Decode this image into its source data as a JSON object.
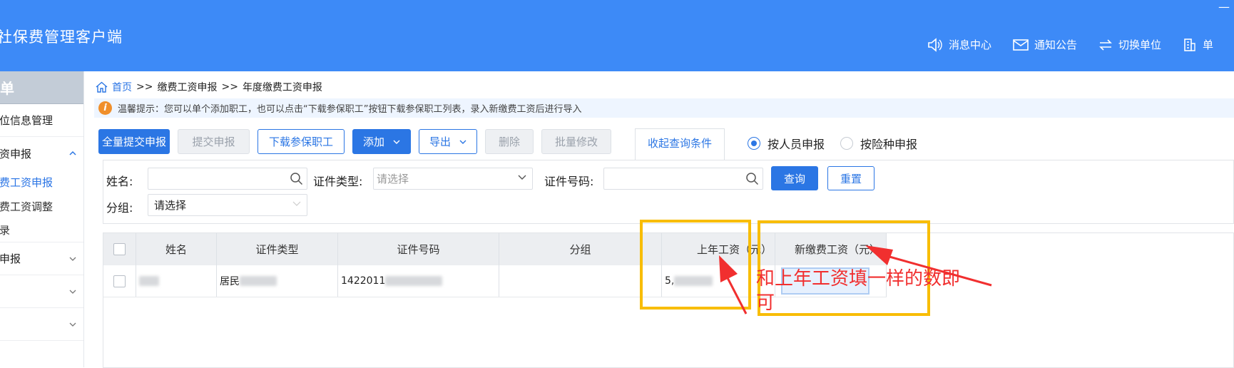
{
  "app": {
    "title": "社保费管理客户端",
    "minimize_glyph": "—"
  },
  "top_nav": [
    {
      "label": "消息中心",
      "icon": "speaker-icon"
    },
    {
      "label": "通知公告",
      "icon": "mail-icon"
    },
    {
      "label": "切换单位",
      "icon": "switch-icon"
    },
    {
      "label": "单",
      "icon": "building-icon"
    }
  ],
  "sidebar": {
    "header": "菜单",
    "items": [
      {
        "label": "单位信息管理"
      },
      {
        "label": "工资申报"
      }
    ],
    "subitems": [
      {
        "label": "缴费工资申报",
        "active": true
      },
      {
        "label": "缴费工资调整"
      },
      {
        "label": "记录"
      }
    ],
    "more_items": [
      {
        "label": "费申报"
      },
      {
        "label": ""
      },
      {
        "label": ""
      }
    ]
  },
  "breadcrumb": {
    "home": "首页",
    "sep": ">>",
    "level2": "缴费工资申报",
    "level3": "年度缴费工资申报"
  },
  "tip": {
    "icon": "i",
    "text": "温馨提示：您可以单个添加职工，也可以点击“下载参保职工”按钮下载参保职工列表，录入新缴费工资后进行导入"
  },
  "toolbar": {
    "submit_all": "全量提交申报",
    "submit": "提交申报",
    "download": "下载参保职工",
    "add": "添加",
    "export": "导出",
    "delete": "删除",
    "batch_edit": "批量修改",
    "collapse": "收起查询条件"
  },
  "radios": [
    {
      "label": "按人员申报",
      "checked": true
    },
    {
      "label": "按险种申报",
      "checked": false
    }
  ],
  "filters": {
    "name_label": "姓名:",
    "id_type_label": "证件类型:",
    "id_type_placeholder": "请选择",
    "id_no_label": "证件号码:",
    "group_label": "分组:",
    "group_value": "请选择",
    "query": "查询",
    "reset": "重置"
  },
  "table": {
    "headers": [
      "姓名",
      "证件类型",
      "证件号码",
      "分组",
      "上年工资（元）",
      "新缴费工资（元）"
    ],
    "rows": [
      {
        "name": "",
        "id_type": "居民",
        "id_no": "1422011",
        "group": "",
        "last_year_salary": "5,"
      }
    ]
  },
  "annotation": {
    "text": "和上年工资填一样的数即可",
    "color": "#f12f2f",
    "box_color": "#f8bd06"
  },
  "colors": {
    "topbar": "#3d8af7",
    "primary": "#2b76e4"
  }
}
